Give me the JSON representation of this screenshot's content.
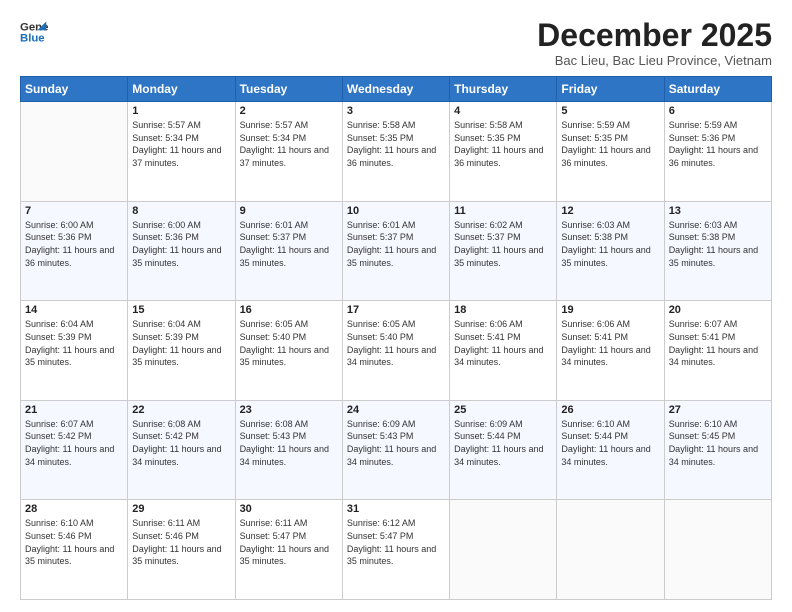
{
  "header": {
    "logo_line1": "General",
    "logo_line2": "Blue",
    "month_title": "December 2025",
    "location": "Bac Lieu, Bac Lieu Province, Vietnam"
  },
  "weekdays": [
    "Sunday",
    "Monday",
    "Tuesday",
    "Wednesday",
    "Thursday",
    "Friday",
    "Saturday"
  ],
  "weeks": [
    [
      {
        "day": "",
        "sunrise": "",
        "sunset": "",
        "daylight": ""
      },
      {
        "day": "1",
        "sunrise": "Sunrise: 5:57 AM",
        "sunset": "Sunset: 5:34 PM",
        "daylight": "Daylight: 11 hours and 37 minutes."
      },
      {
        "day": "2",
        "sunrise": "Sunrise: 5:57 AM",
        "sunset": "Sunset: 5:34 PM",
        "daylight": "Daylight: 11 hours and 37 minutes."
      },
      {
        "day": "3",
        "sunrise": "Sunrise: 5:58 AM",
        "sunset": "Sunset: 5:35 PM",
        "daylight": "Daylight: 11 hours and 36 minutes."
      },
      {
        "day": "4",
        "sunrise": "Sunrise: 5:58 AM",
        "sunset": "Sunset: 5:35 PM",
        "daylight": "Daylight: 11 hours and 36 minutes."
      },
      {
        "day": "5",
        "sunrise": "Sunrise: 5:59 AM",
        "sunset": "Sunset: 5:35 PM",
        "daylight": "Daylight: 11 hours and 36 minutes."
      },
      {
        "day": "6",
        "sunrise": "Sunrise: 5:59 AM",
        "sunset": "Sunset: 5:36 PM",
        "daylight": "Daylight: 11 hours and 36 minutes."
      }
    ],
    [
      {
        "day": "7",
        "sunrise": "Sunrise: 6:00 AM",
        "sunset": "Sunset: 5:36 PM",
        "daylight": "Daylight: 11 hours and 36 minutes."
      },
      {
        "day": "8",
        "sunrise": "Sunrise: 6:00 AM",
        "sunset": "Sunset: 5:36 PM",
        "daylight": "Daylight: 11 hours and 35 minutes."
      },
      {
        "day": "9",
        "sunrise": "Sunrise: 6:01 AM",
        "sunset": "Sunset: 5:37 PM",
        "daylight": "Daylight: 11 hours and 35 minutes."
      },
      {
        "day": "10",
        "sunrise": "Sunrise: 6:01 AM",
        "sunset": "Sunset: 5:37 PM",
        "daylight": "Daylight: 11 hours and 35 minutes."
      },
      {
        "day": "11",
        "sunrise": "Sunrise: 6:02 AM",
        "sunset": "Sunset: 5:37 PM",
        "daylight": "Daylight: 11 hours and 35 minutes."
      },
      {
        "day": "12",
        "sunrise": "Sunrise: 6:03 AM",
        "sunset": "Sunset: 5:38 PM",
        "daylight": "Daylight: 11 hours and 35 minutes."
      },
      {
        "day": "13",
        "sunrise": "Sunrise: 6:03 AM",
        "sunset": "Sunset: 5:38 PM",
        "daylight": "Daylight: 11 hours and 35 minutes."
      }
    ],
    [
      {
        "day": "14",
        "sunrise": "Sunrise: 6:04 AM",
        "sunset": "Sunset: 5:39 PM",
        "daylight": "Daylight: 11 hours and 35 minutes."
      },
      {
        "day": "15",
        "sunrise": "Sunrise: 6:04 AM",
        "sunset": "Sunset: 5:39 PM",
        "daylight": "Daylight: 11 hours and 35 minutes."
      },
      {
        "day": "16",
        "sunrise": "Sunrise: 6:05 AM",
        "sunset": "Sunset: 5:40 PM",
        "daylight": "Daylight: 11 hours and 35 minutes."
      },
      {
        "day": "17",
        "sunrise": "Sunrise: 6:05 AM",
        "sunset": "Sunset: 5:40 PM",
        "daylight": "Daylight: 11 hours and 34 minutes."
      },
      {
        "day": "18",
        "sunrise": "Sunrise: 6:06 AM",
        "sunset": "Sunset: 5:41 PM",
        "daylight": "Daylight: 11 hours and 34 minutes."
      },
      {
        "day": "19",
        "sunrise": "Sunrise: 6:06 AM",
        "sunset": "Sunset: 5:41 PM",
        "daylight": "Daylight: 11 hours and 34 minutes."
      },
      {
        "day": "20",
        "sunrise": "Sunrise: 6:07 AM",
        "sunset": "Sunset: 5:41 PM",
        "daylight": "Daylight: 11 hours and 34 minutes."
      }
    ],
    [
      {
        "day": "21",
        "sunrise": "Sunrise: 6:07 AM",
        "sunset": "Sunset: 5:42 PM",
        "daylight": "Daylight: 11 hours and 34 minutes."
      },
      {
        "day": "22",
        "sunrise": "Sunrise: 6:08 AM",
        "sunset": "Sunset: 5:42 PM",
        "daylight": "Daylight: 11 hours and 34 minutes."
      },
      {
        "day": "23",
        "sunrise": "Sunrise: 6:08 AM",
        "sunset": "Sunset: 5:43 PM",
        "daylight": "Daylight: 11 hours and 34 minutes."
      },
      {
        "day": "24",
        "sunrise": "Sunrise: 6:09 AM",
        "sunset": "Sunset: 5:43 PM",
        "daylight": "Daylight: 11 hours and 34 minutes."
      },
      {
        "day": "25",
        "sunrise": "Sunrise: 6:09 AM",
        "sunset": "Sunset: 5:44 PM",
        "daylight": "Daylight: 11 hours and 34 minutes."
      },
      {
        "day": "26",
        "sunrise": "Sunrise: 6:10 AM",
        "sunset": "Sunset: 5:44 PM",
        "daylight": "Daylight: 11 hours and 34 minutes."
      },
      {
        "day": "27",
        "sunrise": "Sunrise: 6:10 AM",
        "sunset": "Sunset: 5:45 PM",
        "daylight": "Daylight: 11 hours and 34 minutes."
      }
    ],
    [
      {
        "day": "28",
        "sunrise": "Sunrise: 6:10 AM",
        "sunset": "Sunset: 5:46 PM",
        "daylight": "Daylight: 11 hours and 35 minutes."
      },
      {
        "day": "29",
        "sunrise": "Sunrise: 6:11 AM",
        "sunset": "Sunset: 5:46 PM",
        "daylight": "Daylight: 11 hours and 35 minutes."
      },
      {
        "day": "30",
        "sunrise": "Sunrise: 6:11 AM",
        "sunset": "Sunset: 5:47 PM",
        "daylight": "Daylight: 11 hours and 35 minutes."
      },
      {
        "day": "31",
        "sunrise": "Sunrise: 6:12 AM",
        "sunset": "Sunset: 5:47 PM",
        "daylight": "Daylight: 11 hours and 35 minutes."
      },
      {
        "day": "",
        "sunrise": "",
        "sunset": "",
        "daylight": ""
      },
      {
        "day": "",
        "sunrise": "",
        "sunset": "",
        "daylight": ""
      },
      {
        "day": "",
        "sunrise": "",
        "sunset": "",
        "daylight": ""
      }
    ]
  ]
}
